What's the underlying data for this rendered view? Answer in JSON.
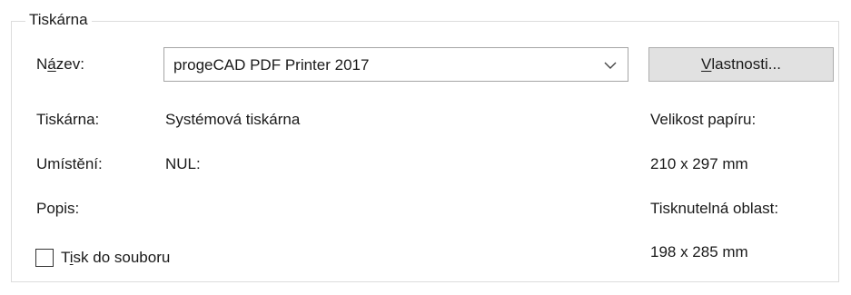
{
  "printer_group": {
    "title": "Tiskárna",
    "name_label": "Název:",
    "name_value": "progeCAD PDF Printer 2017",
    "properties_button": "Vlastnosti...",
    "printer_label": "Tiskárna:",
    "printer_value": "Systémová tiskárna",
    "location_label": "Umístění:",
    "location_value": "NUL:",
    "description_label": "Popis:",
    "print_to_file_label": "Tisk do souboru",
    "print_to_file_checked": false,
    "paper_size_label": "Velikost papíru:",
    "paper_size_value": "210 x 297 mm",
    "printable_area_label": "Tisknutelná oblast:",
    "printable_area_value": "198 x 285 mm"
  },
  "icons": {
    "combo_arrow": "chevron-down-icon"
  }
}
